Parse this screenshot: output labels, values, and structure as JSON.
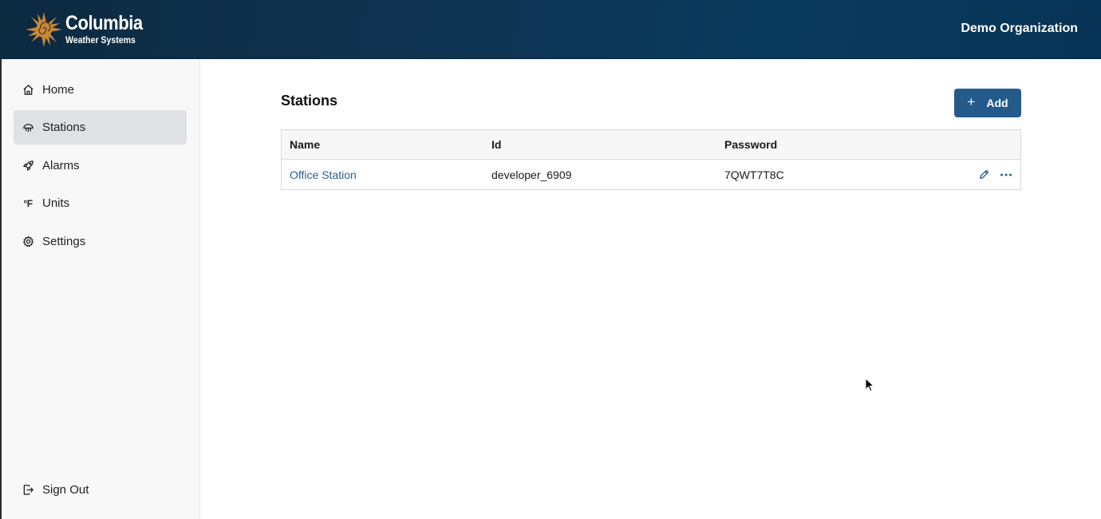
{
  "header": {
    "brand_title": "Columbia",
    "brand_subtitle": "Weather Systems",
    "organization": "Demo Organization"
  },
  "sidebar": {
    "items": [
      {
        "label": "Home",
        "icon": "home-icon"
      },
      {
        "label": "Stations",
        "icon": "station-icon",
        "active": true
      },
      {
        "label": "Alarms",
        "icon": "rocket-icon"
      },
      {
        "label": "Units",
        "icon": "fahrenheit-icon",
        "glyph": "°F"
      },
      {
        "label": "Settings",
        "icon": "gear-icon"
      }
    ],
    "sign_out": {
      "label": "Sign Out",
      "icon": "sign-out-icon"
    }
  },
  "main": {
    "title": "Stations",
    "add_button": "Add",
    "table": {
      "columns": [
        "Name",
        "Id",
        "Password"
      ],
      "rows": [
        {
          "name": "Office Station",
          "id": "developer_6909",
          "password": "7QWT7T8C"
        }
      ]
    }
  },
  "colors": {
    "header_bg": "#0f3352",
    "accent": "#255b8a",
    "link": "#2a5f8f",
    "sidebar_active": "#dfe2e4",
    "logo_sun": "#c8893b"
  }
}
